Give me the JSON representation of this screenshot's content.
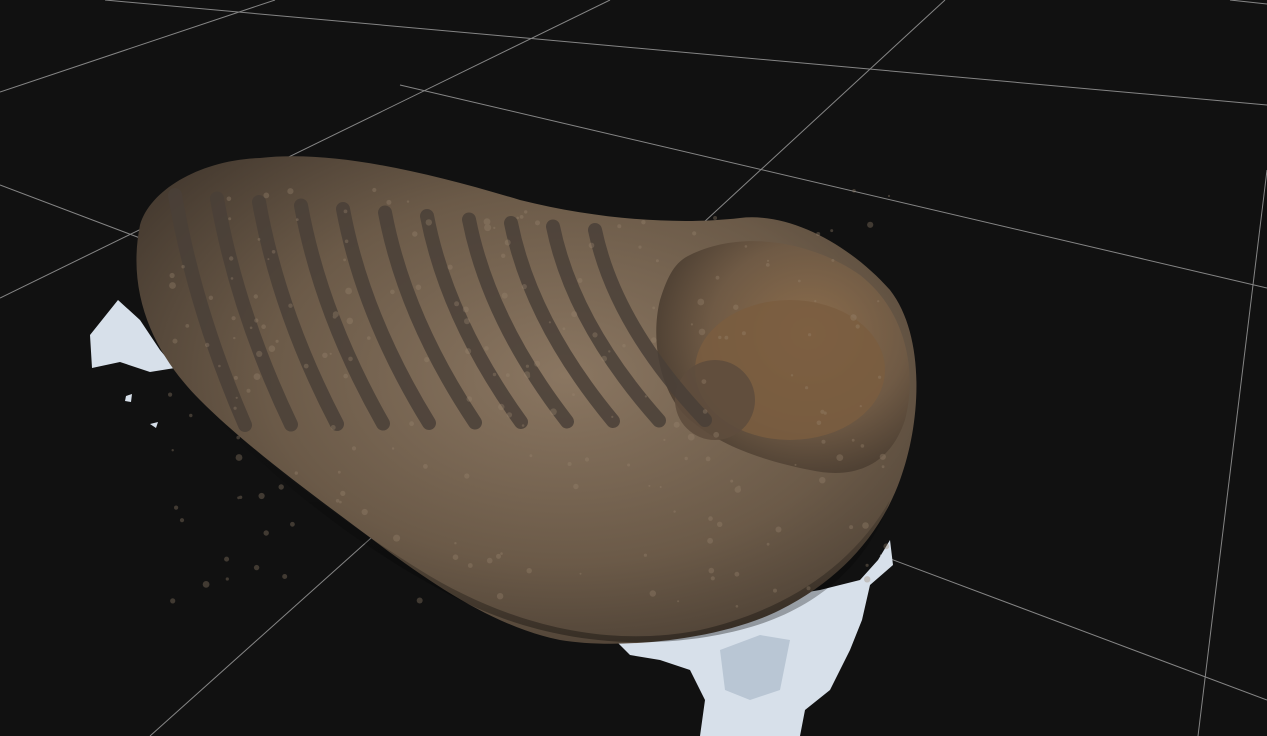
{
  "viewer": {
    "background_color": "#111111",
    "grid_color": "#9a9a9a",
    "grid_visible": true
  },
  "model": {
    "subject": "trilobite-fossil",
    "rock_color": "#6b5a48",
    "rock_dark_color": "#3e342b",
    "rock_highlight_color": "#8a7661",
    "segment_color": "#4a4038",
    "mesh_fragment_color": "#d7e0ea",
    "thorax_segment_count": 11
  }
}
